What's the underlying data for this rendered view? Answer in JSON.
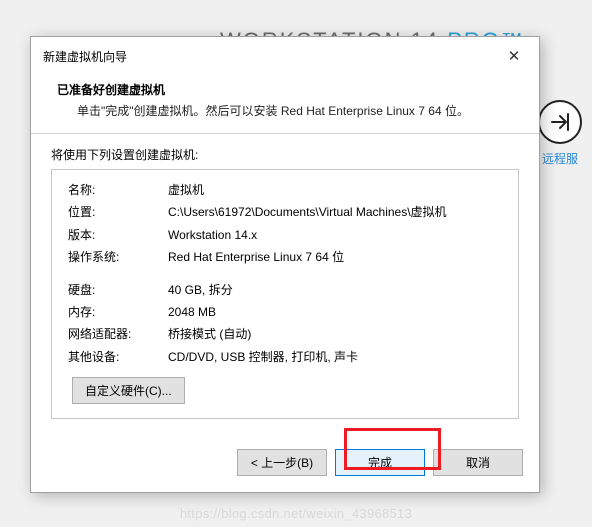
{
  "background": {
    "workstation_text": "WORKSTATION 14",
    "pro_text": " PRO™",
    "remote_label": "远程服"
  },
  "dialog": {
    "title": "新建虚拟机向导",
    "heading": "已准备好创建虚拟机",
    "subheading": "单击\"完成\"创建虚拟机。然后可以安装 Red Hat Enterprise Linux 7 64 位。",
    "intro": "将使用下列设置创建虚拟机:",
    "rows": {
      "name_label": "名称:",
      "name_value": "虚拟机",
      "location_label": "位置:",
      "location_value": "C:\\Users\\61972\\Documents\\Virtual Machines\\虚拟机",
      "version_label": "版本:",
      "version_value": "Workstation 14.x",
      "os_label": "操作系统:",
      "os_value": "Red Hat Enterprise Linux 7 64 位",
      "disk_label": "硬盘:",
      "disk_value": "40 GB, 拆分",
      "memory_label": "内存:",
      "memory_value": "2048 MB",
      "network_label": "网络适配器:",
      "network_value": "桥接模式 (自动)",
      "other_label": "其他设备:",
      "other_value": "CD/DVD, USB 控制器, 打印机, 声卡"
    },
    "customize_button": "自定义硬件(C)...",
    "buttons": {
      "back": "< 上一步(B)",
      "finish": "完成",
      "cancel": "取消"
    }
  },
  "watermark": "https://blog.csdn.net/weixin_43968513"
}
